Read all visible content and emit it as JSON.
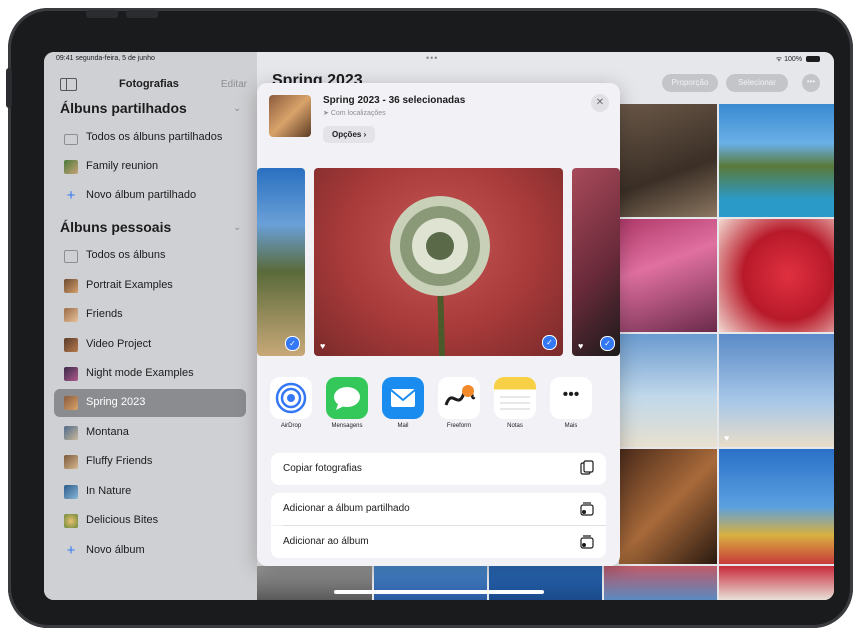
{
  "status_bar": {
    "time_date": "09:41 segunda-feira, 5 de junho",
    "dots": "•••",
    "battery": "100%"
  },
  "sidebar": {
    "title": "Fotografias",
    "edit": "Editar",
    "sections": [
      {
        "title": "Álbuns partilhados",
        "items": [
          {
            "label": "Todos os álbuns partilhados",
            "icon": "shared-albums-icon"
          },
          {
            "label": "Family reunion",
            "icon": "album-thumb"
          },
          {
            "label": "Novo álbum partilhado",
            "icon": "plus-icon"
          }
        ]
      },
      {
        "title": "Álbuns pessoais",
        "items": [
          {
            "label": "Todos os álbuns",
            "icon": "albums-icon"
          },
          {
            "label": "Portrait Examples",
            "icon": "album-thumb"
          },
          {
            "label": "Friends",
            "icon": "album-thumb"
          },
          {
            "label": "Video Project",
            "icon": "album-thumb"
          },
          {
            "label": "Night mode Examples",
            "icon": "album-thumb"
          },
          {
            "label": "Spring 2023",
            "icon": "album-thumb",
            "selected": true
          },
          {
            "label": "Montana",
            "icon": "album-thumb"
          },
          {
            "label": "Fluffy Friends",
            "icon": "album-thumb"
          },
          {
            "label": "In Nature",
            "icon": "album-thumb"
          },
          {
            "label": "Delicious Bites",
            "icon": "album-thumb"
          },
          {
            "label": "Novo álbum",
            "icon": "plus-icon"
          }
        ]
      }
    ]
  },
  "main": {
    "title": "Spring 2023",
    "toolbar": {
      "btn1": "Proporção",
      "btn2": "Selecionar",
      "more": "•••"
    }
  },
  "share_sheet": {
    "title": "Spring 2023 - 36 selecionadas",
    "subtitle": "Com localizações",
    "options": "Opções",
    "close": "✕",
    "apps": [
      {
        "label": "AirDrop",
        "icon": "airdrop-icon"
      },
      {
        "label": "Mensagens",
        "icon": "messages-icon"
      },
      {
        "label": "Mail",
        "icon": "mail-icon"
      },
      {
        "label": "Freeform",
        "icon": "freeform-icon"
      },
      {
        "label": "Notas",
        "icon": "notes-icon"
      },
      {
        "label": "Mais",
        "icon": "more-icon"
      }
    ],
    "actions": [
      {
        "label": "Copiar fotografias",
        "icon": "copy-icon"
      },
      {
        "label": "Adicionar a álbum partilhado",
        "icon": "shared-album-add-icon"
      },
      {
        "label": "Adicionar ao álbum",
        "icon": "album-add-icon"
      }
    ]
  },
  "colors": {
    "accent": "#3478f6",
    "sidebar_bg": "#cfd0d3",
    "selected_bg": "#8b8c90"
  }
}
